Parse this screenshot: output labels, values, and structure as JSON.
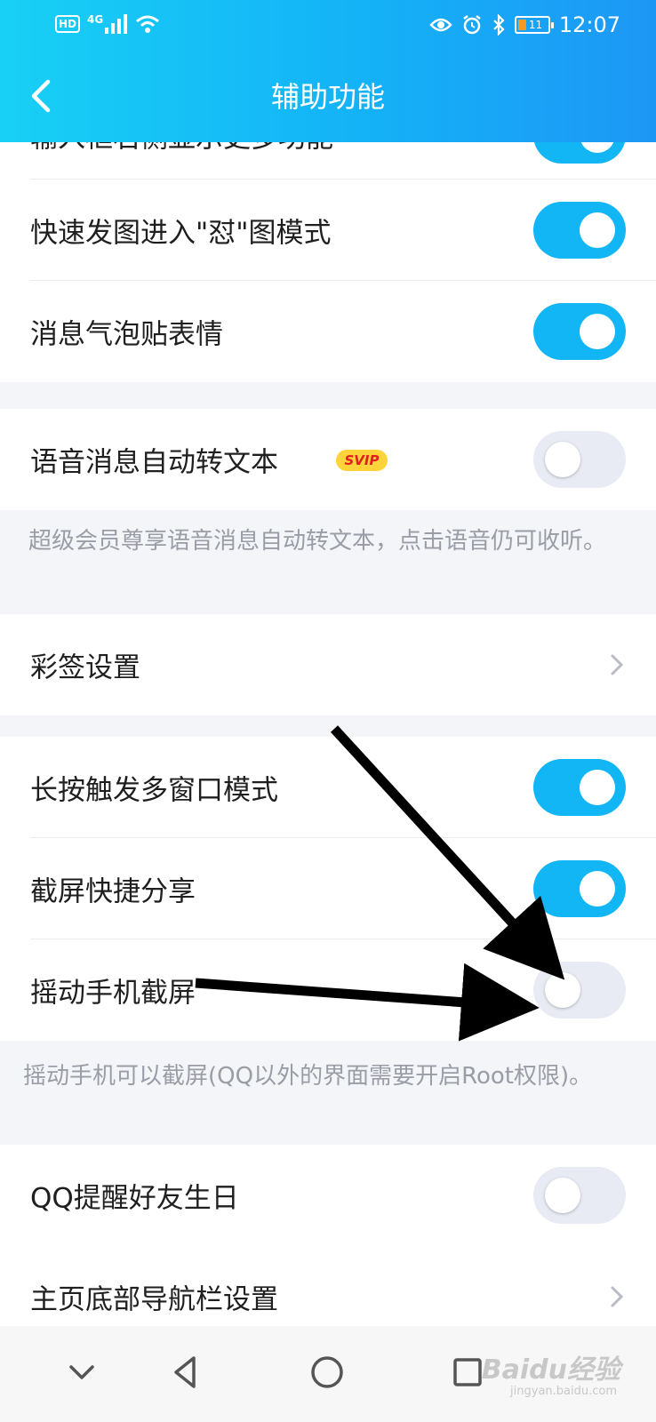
{
  "status_bar": {
    "hd": "HD",
    "network": "4G",
    "battery": "11",
    "time": "12:07"
  },
  "header": {
    "title": "辅助功能"
  },
  "settings": {
    "partial_label": "输入框右侧显示更多功能",
    "quick_image": "快速发图进入\"怼\"图模式",
    "bubble_sticker": "消息气泡贴表情",
    "voice_to_text": "语音消息自动转文本",
    "svip_badge": "SVIP",
    "voice_note": "超级会员尊享语音消息自动转文本，点击语音仍可收听。",
    "color_sign": "彩签设置",
    "long_press_window": "长按触发多窗口模式",
    "screenshot_share": "截屏快捷分享",
    "shake_screenshot": "摇动手机截屏",
    "shake_note": "摇动手机可以截屏(QQ以外的界面需要开启Root权限)。",
    "birthday_reminder": "QQ提醒好友生日",
    "bottom_nav": "主页底部导航栏设置"
  },
  "toggle_states": {
    "partial": true,
    "quick_image": true,
    "bubble_sticker": true,
    "voice_to_text": false,
    "long_press_window": true,
    "screenshot_share": true,
    "shake_screenshot": false,
    "birthday_reminder": false
  },
  "watermark": {
    "brand": "Baidu经验",
    "url": "jingyan.baidu.com"
  },
  "colors": {
    "accent": "#12b6f5",
    "toggle_off": "#e8ebf3",
    "svip_bg": "#ffd43a",
    "svip_text": "#e02020"
  }
}
